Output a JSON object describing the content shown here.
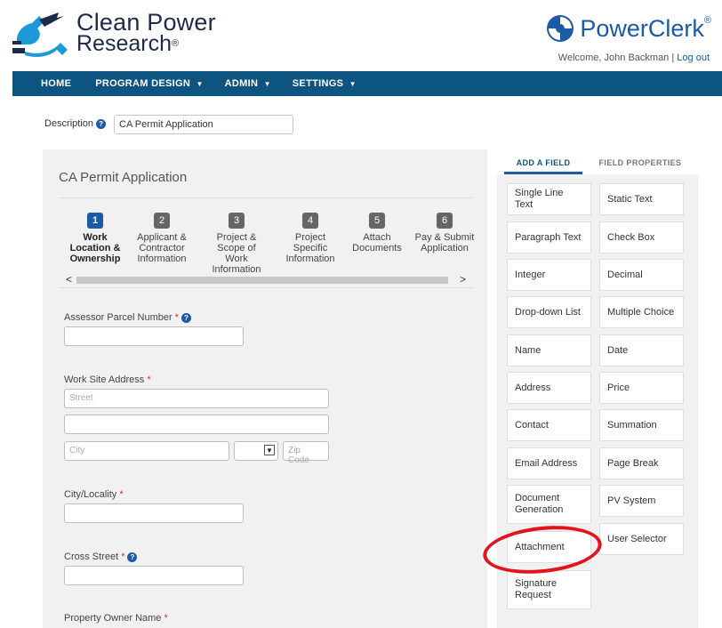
{
  "header": {
    "brand_line1": "Clean Power",
    "brand_line2": "Research",
    "brand_reg": "®",
    "product": "PowerClerk",
    "product_reg": "®",
    "welcome_text": "Welcome, John Backman",
    "separator": " | ",
    "logout": "Log out"
  },
  "nav": [
    {
      "label": "HOME",
      "caret": ""
    },
    {
      "label": "PROGRAM DESIGN",
      "caret": "▼"
    },
    {
      "label": "ADMIN",
      "caret": "▼"
    },
    {
      "label": "SETTINGS",
      "caret": "▼"
    }
  ],
  "description": {
    "label": "Description",
    "value": "CA Permit Application"
  },
  "form": {
    "title": "CA Permit Application",
    "steps": [
      {
        "num": "1",
        "label": "Work Location & Ownership"
      },
      {
        "num": "2",
        "label": "Applicant & Contractor Information"
      },
      {
        "num": "3",
        "label": "Project & Scope of Work Information"
      },
      {
        "num": "4",
        "label": "Project Specific Information"
      },
      {
        "num": "5",
        "label": "Attach Documents"
      },
      {
        "num": "6",
        "label": "Pay & Submit Application"
      }
    ],
    "scroll_left": "<",
    "scroll_right": ">",
    "required_mark": "*",
    "fields": {
      "apn": "Assessor Parcel Number",
      "work_site": "Work Site Address",
      "street_placeholder": "Street",
      "city_placeholder": "City",
      "zip_placeholder": "Zip Code",
      "city_locality": "City/Locality",
      "cross_street": "Cross Street",
      "owner_name": "Property Owner Name"
    }
  },
  "panel": {
    "tab_add": "ADD A FIELD",
    "tab_props": "FIELD PROPERTIES",
    "left_fields": [
      "Single Line Text",
      "Paragraph Text",
      "Integer",
      "Drop-down List",
      "Name",
      "Address",
      "Contact",
      "Email Address",
      "Document Generation",
      "Attachment",
      "Signature Request"
    ],
    "right_fields": [
      "Static Text",
      "Check Box",
      "Decimal",
      "Multiple Choice",
      "Date",
      "Price",
      "Summation",
      "Page Break",
      "PV System",
      "User Selector"
    ]
  },
  "colors": {
    "nav_bg": "#0e5480",
    "accent": "#1d5aa6",
    "highlight": "#e3141c",
    "required": "#d9342b"
  }
}
